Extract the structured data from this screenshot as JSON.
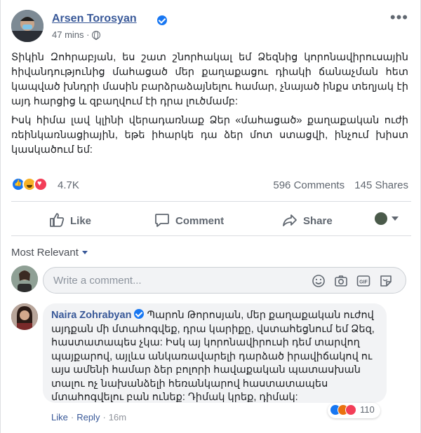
{
  "post": {
    "author": "Arsen Torosyan",
    "time": "47 mins",
    "paragraphs": [
      "Տիկին Զոհրաբյան, ես շատ շնորհակալ եմ Ձեզնից կորոնավիրուսային հիվանդությունից մահացած մեր քաղաքացու դիակի ճանաչման հետ կապված խնդրի մասին բարձրաձայնելու համար, չնայած ինքս տեղյակ էի այդ հարցից և զբաղվում էի դրա լուծմամբ:",
      "Իսկ հիմա լավ կլինի վերադառնաք Ձեր «մահացած» քաղաքական ուժի ռեինկառնացիային, եթե իհարկե դա ձեր մոտ ստացվի, ինչում խիստ կասկածում եմ:"
    ],
    "reaction_count": "4.7K",
    "comments_count": "596 Comments",
    "shares_count": "145 Shares"
  },
  "actions": {
    "like": "Like",
    "comment": "Comment",
    "share": "Share"
  },
  "sort_label": "Most Relevant",
  "composer": {
    "placeholder": "Write a comment..."
  },
  "comment": {
    "author": "Naira Zohrabyan",
    "text": "Պարոն Թորոսյան, մեր քաղաքական ուժով այդքան մի մտահոգվեք, դրա կարիքը, վստահեցնում եմ Ձեզ, հաստատապես չկա: Իսկ այ կորոնավիրուսի դեմ տարվող պայքարով, այլևս անկառավարելի դարձած իրավիճակով ու այս ամենի համար ձեր բոլորի հավաքական պատասխան տալու ոչ նախանձելի հեռանկարով հաստատապես մտահոգվելու բան ունեք: Դիմակ կրեք, դիմակ:",
    "reaction_count": "110",
    "like": "Like",
    "reply": "Reply",
    "time": "16m"
  }
}
